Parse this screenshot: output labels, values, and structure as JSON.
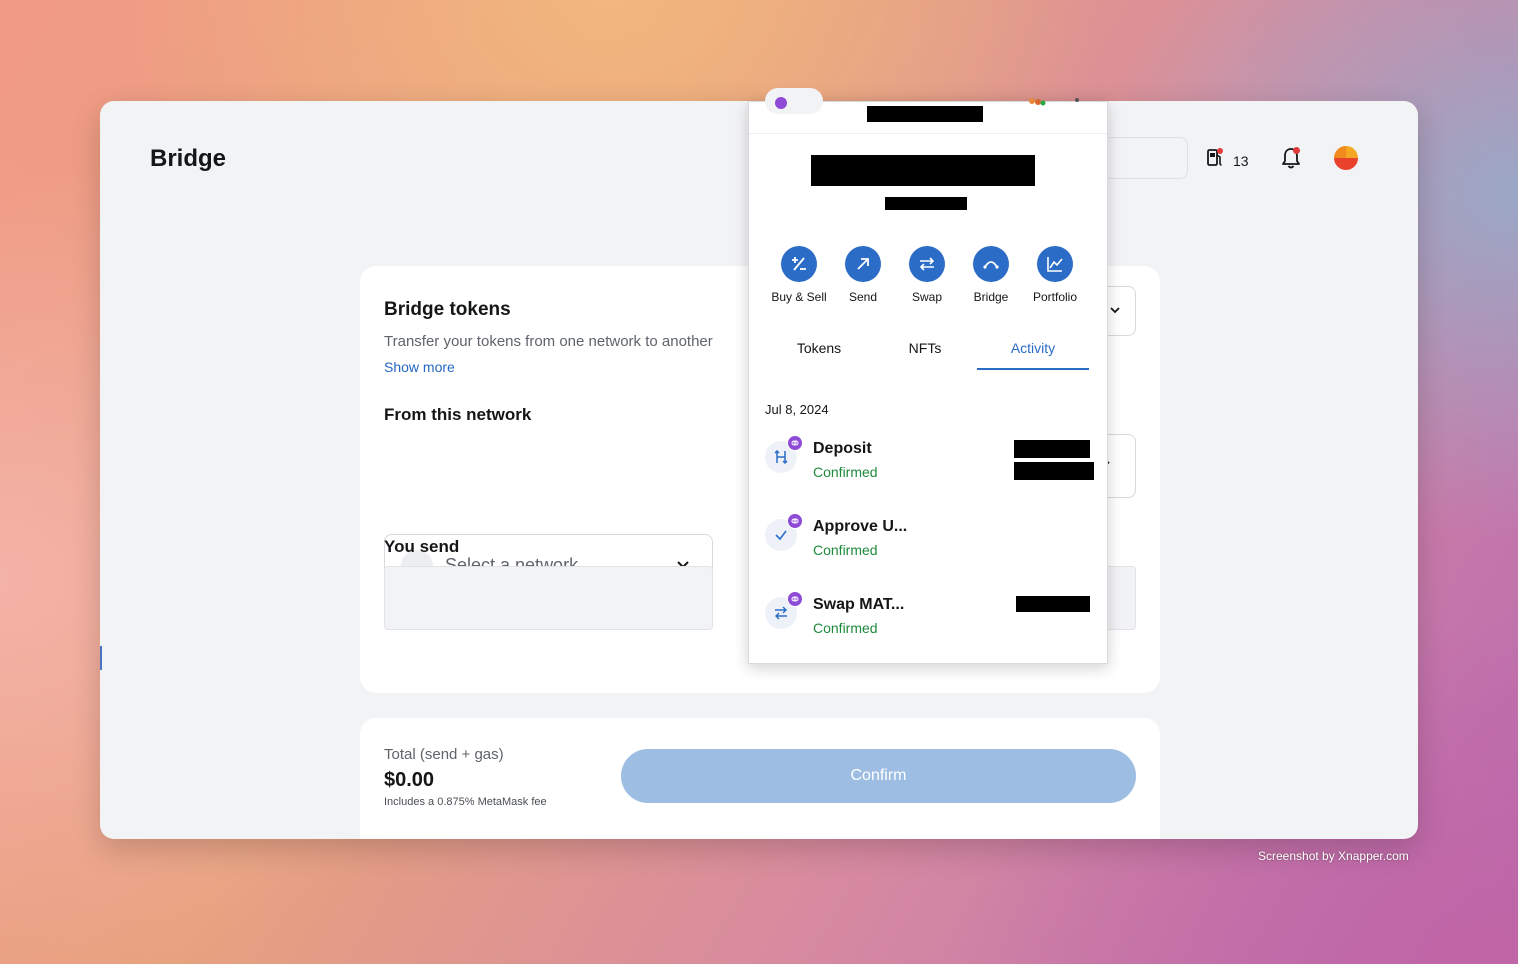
{
  "header": {
    "title": "Bridge",
    "gas_count": "13"
  },
  "bridge_card": {
    "title": "Bridge tokens",
    "description": "Transfer your tokens from one network to another",
    "show_more": "Show more",
    "from_label": "From this network",
    "network_placeholder": "Select a network",
    "you_send_label": "You send"
  },
  "footer": {
    "total_label": "Total (send + gas)",
    "total_value": "$0.00",
    "fee_note": "Includes a 0.875% MetaMask fee",
    "confirm_label": "Confirm"
  },
  "popup": {
    "actions": [
      {
        "label": "Buy & Sell",
        "icon": "buy-sell-icon"
      },
      {
        "label": "Send",
        "icon": "send-arrow-icon"
      },
      {
        "label": "Swap",
        "icon": "swap-icon"
      },
      {
        "label": "Bridge",
        "icon": "bridge-icon"
      },
      {
        "label": "Portfolio",
        "icon": "portfolio-chart-icon"
      }
    ],
    "tabs": [
      {
        "label": "Tokens",
        "active": false
      },
      {
        "label": "NFTs",
        "active": false
      },
      {
        "label": "Activity",
        "active": true
      }
    ],
    "activity_date": "Jul 8, 2024",
    "transactions": [
      {
        "title": "Deposit",
        "status": "Confirmed",
        "icon": "deposit-icon"
      },
      {
        "title": "Approve U...",
        "status": "Confirmed",
        "icon": "check-icon"
      },
      {
        "title": "Swap MAT...",
        "status": "Confirmed",
        "icon": "swap-icon"
      }
    ],
    "accent_color": "#2b6cc6",
    "confirmed_color": "#1d8a3c"
  },
  "credit": "Screenshot by Xnapper.com"
}
